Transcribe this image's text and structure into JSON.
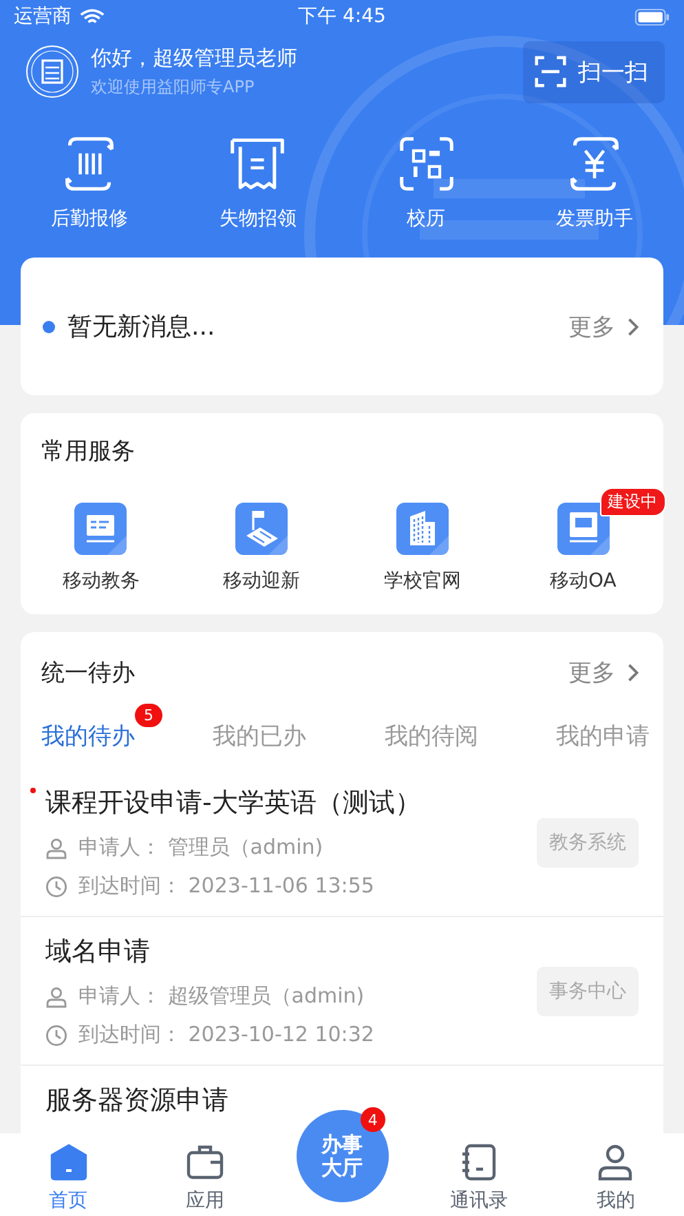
{
  "status_bar": {
    "carrier": "运营商",
    "time": "下午 4:45"
  },
  "header": {
    "greeting": "你好，超级管理员老师",
    "subtitle": "欢迎使用益阳师专APP",
    "scan_button": "扫一扫"
  },
  "quick_actions": [
    {
      "label": "后勤报修",
      "kind": "repair"
    },
    {
      "label": "失物招领",
      "kind": "receipt"
    },
    {
      "label": "校历",
      "kind": "qr"
    },
    {
      "label": "发票助手",
      "kind": "yen"
    }
  ],
  "notice": {
    "text": "暂无新消息...",
    "more": "更多"
  },
  "services": {
    "title": "常用服务",
    "items": [
      {
        "label": "移动教务",
        "kind": "board"
      },
      {
        "label": "移动迎新",
        "kind": "flag"
      },
      {
        "label": "学校官网",
        "kind": "building"
      },
      {
        "label": "移动OA",
        "kind": "oa",
        "badge": "建设中"
      }
    ]
  },
  "todo": {
    "title": "统一待办",
    "more": "更多",
    "tabs": [
      {
        "label": "我的待办",
        "selected": true,
        "badge": "5"
      },
      {
        "label": "我的已办",
        "selected": false
      },
      {
        "label": "我的待阅",
        "selected": false
      },
      {
        "label": "我的申请",
        "selected": false
      }
    ],
    "items": [
      {
        "title": "课程开设申请-大学英语（测试）",
        "unread": true,
        "applicant": "申请人：  管理员（admin)",
        "time": "到达时间：  2023-11-06 13:55",
        "tag": "教务系统"
      },
      {
        "title": "域名申请",
        "unread": false,
        "applicant": "申请人：  超级管理员（admin)",
        "time": "到达时间：  2023-10-12 10:32",
        "tag": "事务中心"
      },
      {
        "title": "服务器资源申请",
        "unread": false
      }
    ]
  },
  "tab_bar": {
    "items": [
      {
        "label": "首页",
        "kind": "home",
        "selected": true
      },
      {
        "label": "应用",
        "kind": "bag",
        "selected": false
      },
      {
        "label": "办事大厅",
        "kind": "center",
        "badge": "4"
      },
      {
        "label": "通讯录",
        "kind": "book",
        "selected": false
      },
      {
        "label": "我的",
        "kind": "person",
        "selected": false
      }
    ]
  }
}
